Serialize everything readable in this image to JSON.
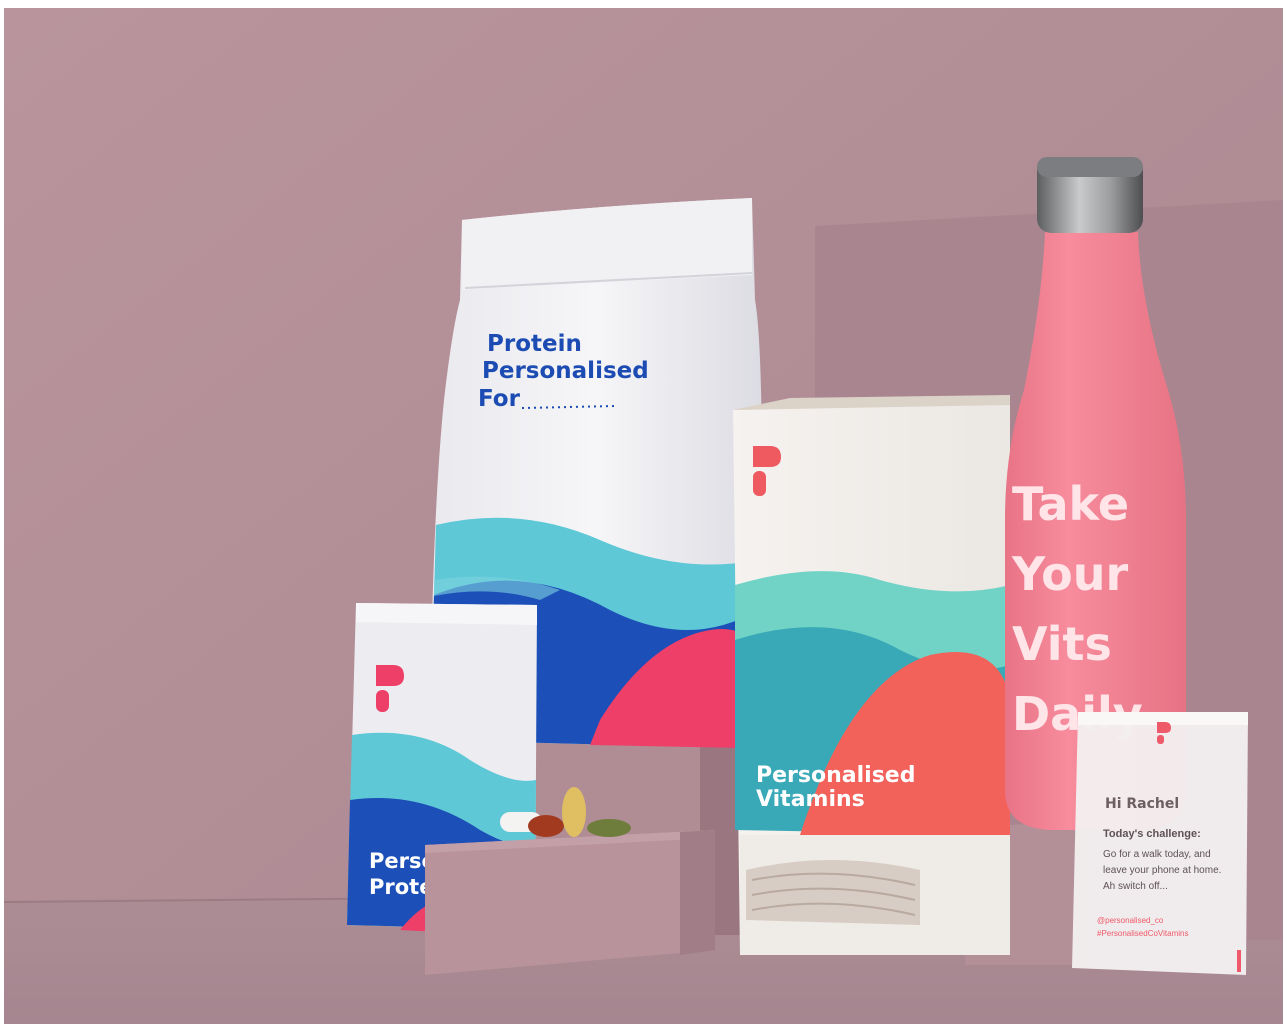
{
  "image": {
    "description_colors": {
      "wall": "#b8939b",
      "floor": "#a98892",
      "bottle": "#f58a9b",
      "accent_red": "#f0606a",
      "blue": "#1b4bb3",
      "teal": "#5cc5cf"
    }
  },
  "products": {
    "protein_bag": {
      "line1": "Protein",
      "line2": "Personalised",
      "line3": "For"
    },
    "small_pouch": {
      "line1": "Perso",
      "line2": "Protei"
    },
    "vitamin_box": {
      "line1": "Personalised",
      "line2": "Vitamins"
    },
    "bottle": {
      "line1": "Take",
      "line2": "Your",
      "line3": "Vits",
      "line4": "Daily"
    },
    "sachet": {
      "greeting": "Hi Rachel",
      "challenge_title": "Today's challenge:",
      "challenge_line1": "Go for a walk today, and",
      "challenge_line2": "leave your phone at home.",
      "challenge_line3": "Ah switch off...",
      "handle1": "@personalised_co",
      "handle2": "#PersonalisedCoVitamins"
    }
  }
}
